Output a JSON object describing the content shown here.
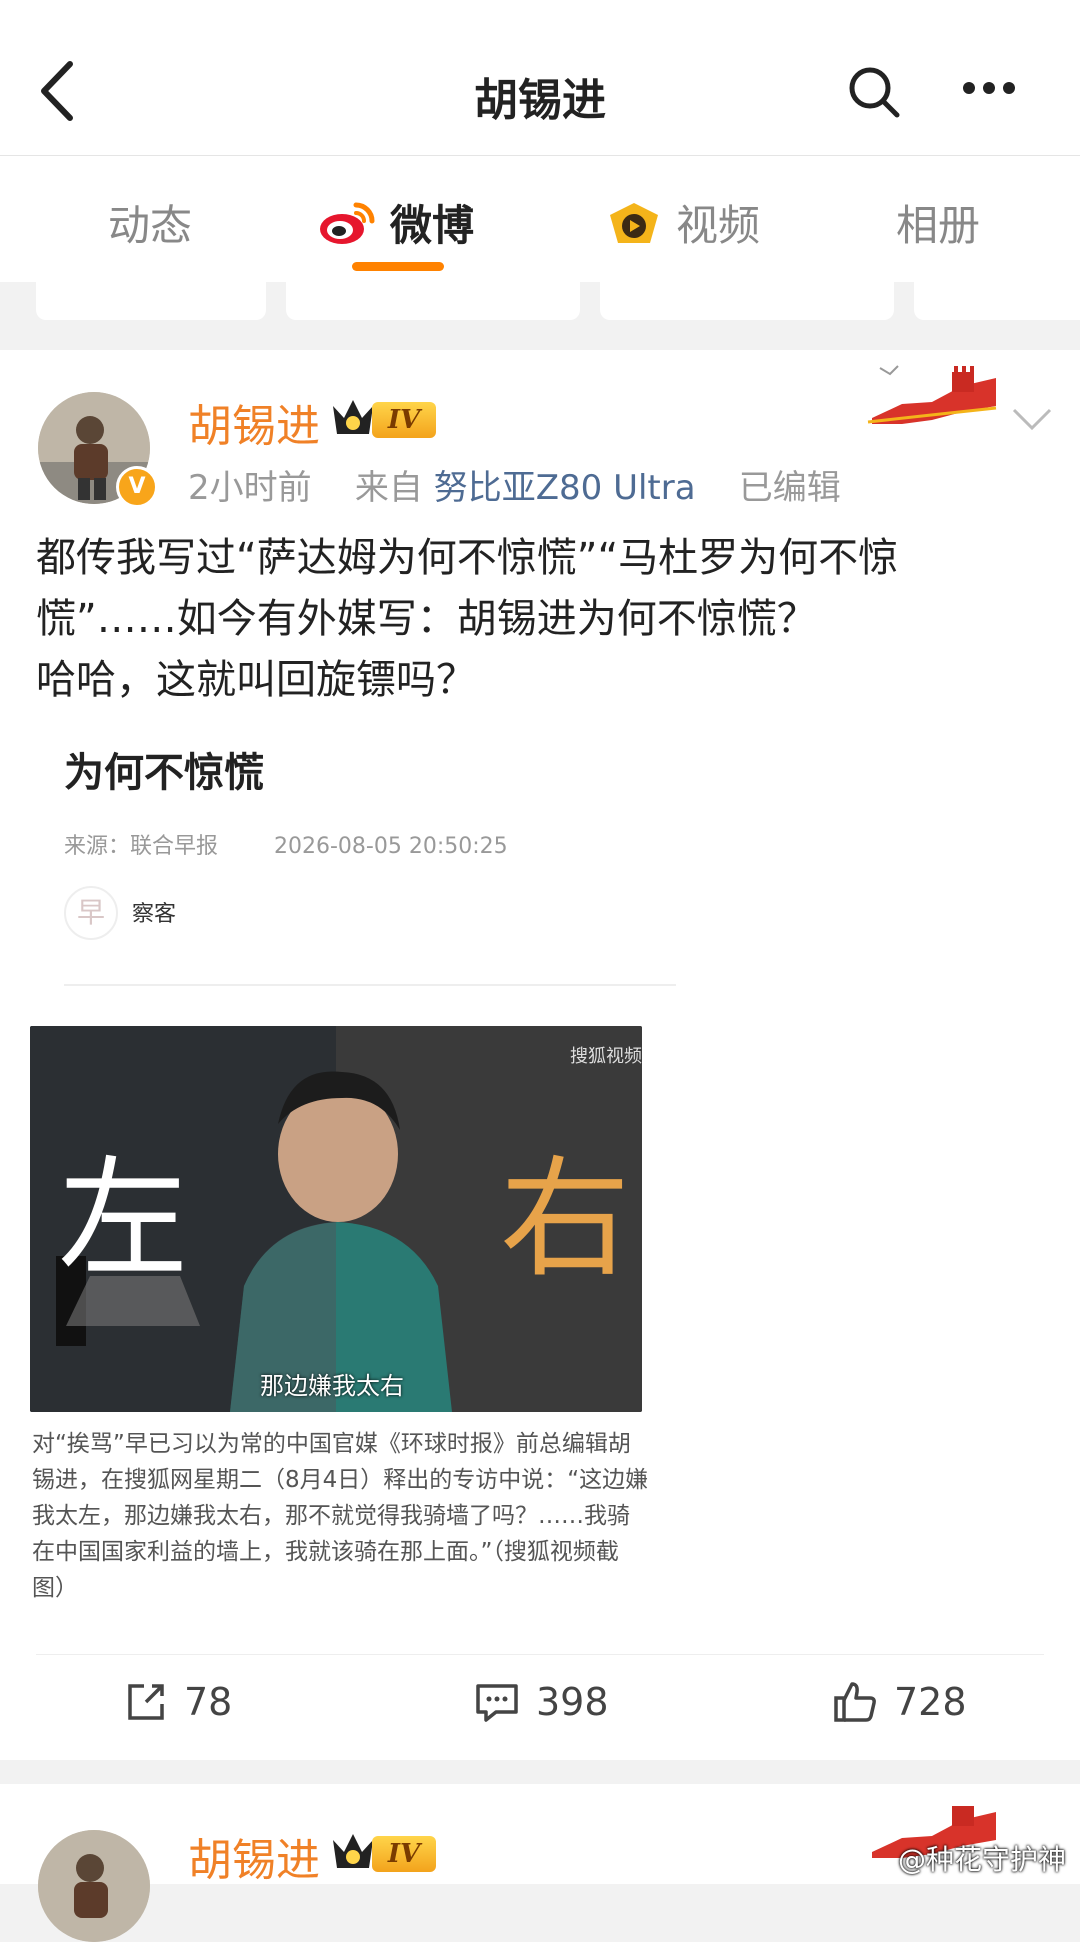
{
  "header": {
    "title": "胡锡进"
  },
  "tabs": [
    {
      "label": "动态"
    },
    {
      "label": "微博"
    },
    {
      "label": "视频"
    },
    {
      "label": "相册"
    }
  ],
  "post": {
    "author": "胡锡进",
    "level": "IV",
    "time": "2小时前",
    "from_prefix": "来自",
    "device": "努比亚Z80 Ultra",
    "edited": "已编辑",
    "text_lines": [
      "都传我写过“萨达姆为何不惊慌”“马杜罗为何不惊",
      "慌”……如今有外媒写：胡锡进为何不惊慌？",
      "哈哈，这就叫回旋镖吗？"
    ],
    "embedded": {
      "title": "为何不惊慌",
      "source": "来源：联合早报",
      "datetime": "2026-08-05 20:50:25",
      "author": "察客",
      "photo_left_char": "左",
      "photo_right_char": "右",
      "photo_subtitle": "那边嫌我太右",
      "photo_corner": "搜狐视频",
      "caption": "对“挨骂”早已习以为常的中国官媒《环球时报》前总编辑胡锡进，在搜狐网星期二（8月4日）释出的专访中说：“这边嫌我太左，那边嫌我太右，那不就觉得我骑墙了吗？……我骑在中国国家利益的墙上，我就该骑在那上面。”（搜狐视频截图）"
    },
    "actions": {
      "repost": "78",
      "comment": "398",
      "like": "728"
    }
  },
  "next_post": {
    "author": "胡锡进",
    "level": "IV"
  },
  "watermark": "@种花守护神",
  "colors": {
    "accent": "#ff8200",
    "username": "#f08127",
    "link": "#4e6b93"
  }
}
